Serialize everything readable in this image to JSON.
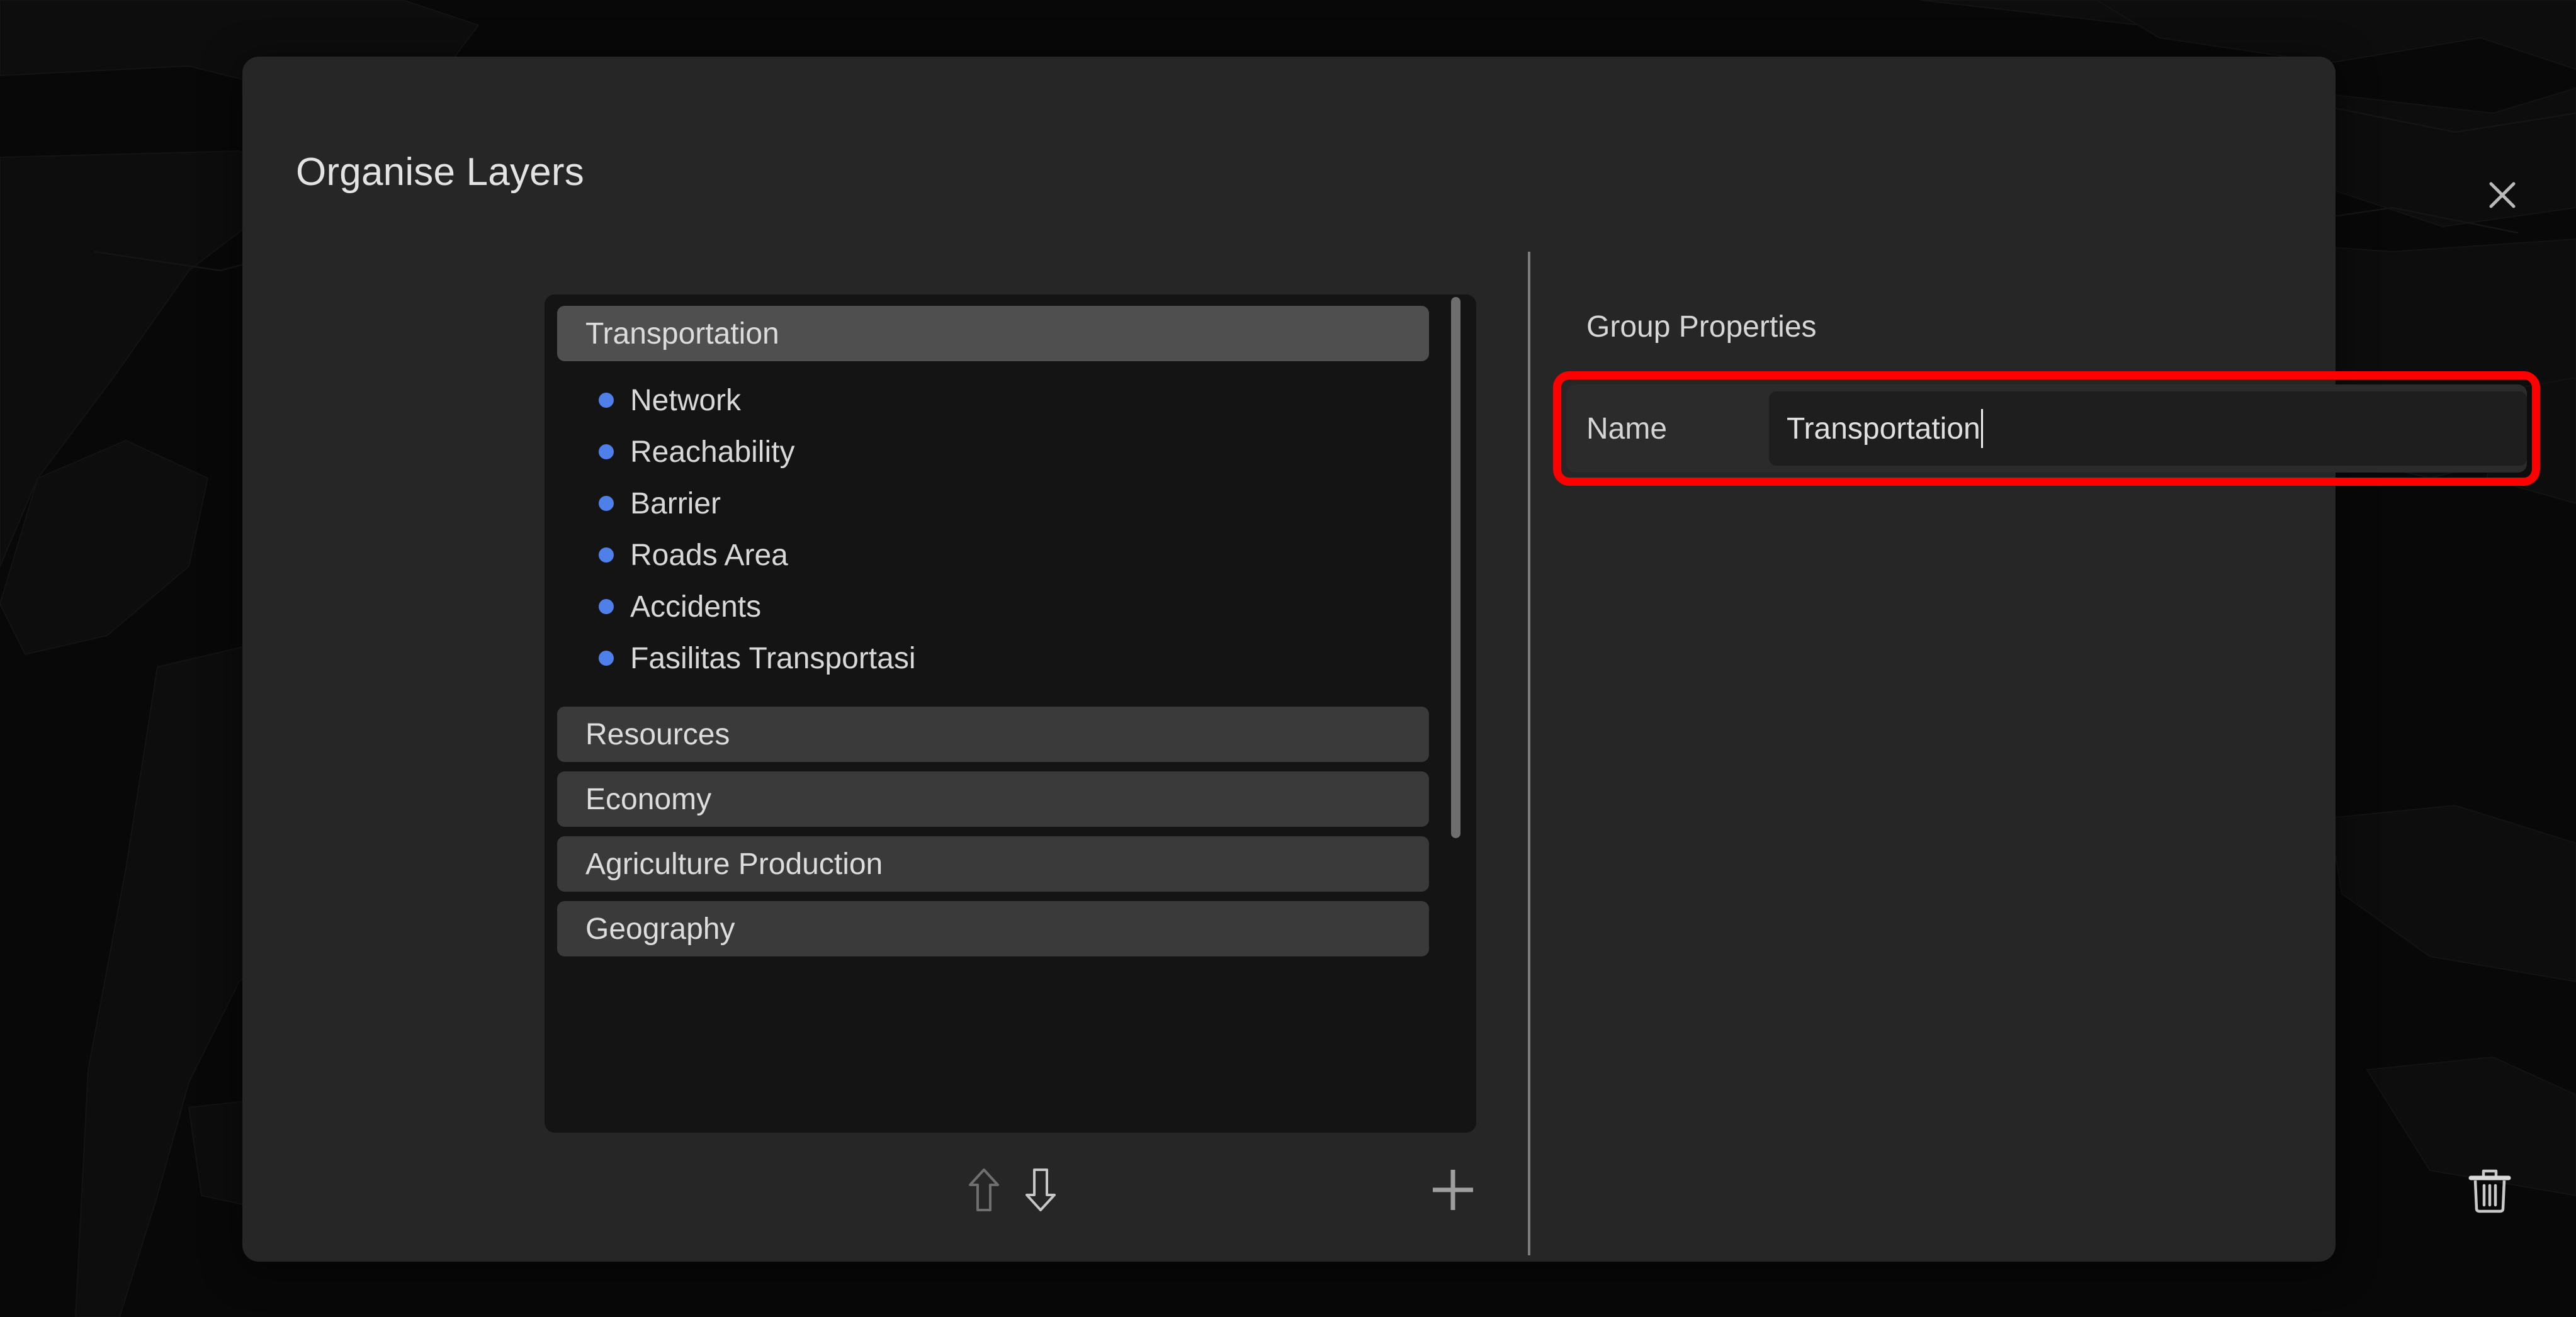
{
  "dialog": {
    "title": "Organise Layers",
    "close_icon": "close-icon"
  },
  "layer_list": {
    "groups": [
      {
        "name": "Transportation",
        "selected": true,
        "expanded": true,
        "layers": [
          {
            "name": "Network"
          },
          {
            "name": "Reachability"
          },
          {
            "name": "Barrier"
          },
          {
            "name": "Roads Area"
          },
          {
            "name": "Accidents"
          },
          {
            "name": "Fasilitas Transportasi"
          }
        ]
      },
      {
        "name": "Resources",
        "selected": false,
        "expanded": false,
        "layers": []
      },
      {
        "name": "Economy",
        "selected": false,
        "expanded": false,
        "layers": []
      },
      {
        "name": "Agriculture Production",
        "selected": false,
        "expanded": false,
        "layers": []
      },
      {
        "name": "Geography",
        "selected": false,
        "expanded": false,
        "layers": []
      }
    ],
    "scrollbar": {
      "visible": true
    }
  },
  "footer": {
    "move_up_icon": "arrow-up-icon",
    "move_down_icon": "arrow-down-icon",
    "add_icon": "plus-icon",
    "delete_icon": "trash-icon"
  },
  "properties": {
    "heading": "Group Properties",
    "name_label": "Name",
    "name_value": "Transportation",
    "name_placeholder": "",
    "focused": true
  },
  "colors": {
    "dialog_background": "#262626",
    "list_background": "#141414",
    "group_row": "#3a3a3a",
    "group_row_selected": "#4f4f4f",
    "layer_bullet": "#4f7fe8",
    "highlight_border": "#fe0000",
    "input_background": "#1e1e1e",
    "text_primary": "#e0e0e0",
    "divider": "#7d7d7d"
  }
}
